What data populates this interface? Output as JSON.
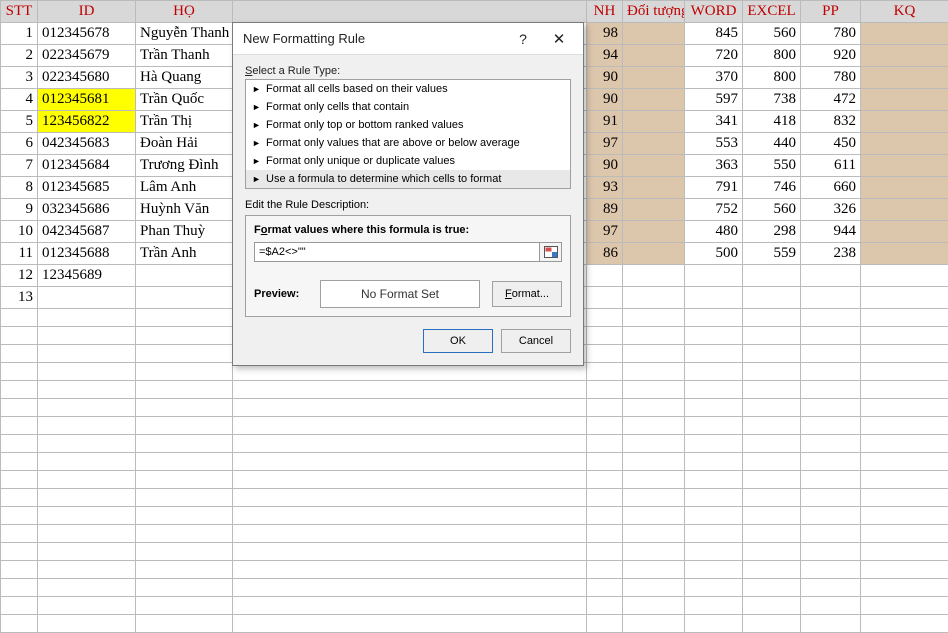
{
  "headers": {
    "stt": "STT",
    "id": "ID",
    "hq": "HỌ",
    "nh": "NH",
    "dt": "Đối tượng",
    "word": "WORD",
    "excel": "EXCEL",
    "pp": "PP",
    "kq": "KQ"
  },
  "rows": [
    {
      "stt": "1",
      "id": "012345678",
      "hq": "Nguyễn Thanh",
      "nh": "98",
      "word": "845",
      "excel": "560",
      "pp": "780",
      "hl": false
    },
    {
      "stt": "2",
      "id": "022345679",
      "hq": "Trần Thanh",
      "nh": "94",
      "word": "720",
      "excel": "800",
      "pp": "920",
      "hl": false
    },
    {
      "stt": "3",
      "id": "022345680",
      "hq": "Hà Quang",
      "nh": "90",
      "word": "370",
      "excel": "800",
      "pp": "780",
      "hl": false
    },
    {
      "stt": "4",
      "id": "012345681",
      "hq": "Trần Quốc",
      "nh": "90",
      "word": "597",
      "excel": "738",
      "pp": "472",
      "hl": true
    },
    {
      "stt": "5",
      "id": "123456822",
      "hq": "Trần Thị",
      "nh": "91",
      "word": "341",
      "excel": "418",
      "pp": "832",
      "hl": true
    },
    {
      "stt": "6",
      "id": "042345683",
      "hq": "Đoàn Hải",
      "nh": "97",
      "word": "553",
      "excel": "440",
      "pp": "450",
      "hl": false
    },
    {
      "stt": "7",
      "id": "012345684",
      "hq": "Trương Đình",
      "nh": "90",
      "word": "363",
      "excel": "550",
      "pp": "611",
      "hl": false
    },
    {
      "stt": "8",
      "id": "012345685",
      "hq": "Lâm Anh",
      "nh": "93",
      "word": "791",
      "excel": "746",
      "pp": "660",
      "hl": false
    },
    {
      "stt": "9",
      "id": "032345686",
      "hq": "Huỳnh Văn",
      "nh": "89",
      "word": "752",
      "excel": "560",
      "pp": "326",
      "hl": false
    },
    {
      "stt": "10",
      "id": "042345687",
      "hq": "Phan Thuỳ",
      "nh": "97",
      "word": "480",
      "excel": "298",
      "pp": "944",
      "hl": false
    },
    {
      "stt": "11",
      "id": "012345688",
      "hq": "Trần Anh",
      "nh": "86",
      "word": "500",
      "excel": "559",
      "pp": "238",
      "hl": false
    }
  ],
  "extra_rows": [
    {
      "stt": "12",
      "id": "12345689"
    },
    {
      "stt": "13",
      "id": ""
    }
  ],
  "dialog": {
    "title": "New Formatting Rule",
    "help": "?",
    "close": "✕",
    "select_label": "Select a Rule Type:",
    "rule_types": [
      "Format all cells based on their values",
      "Format only cells that contain",
      "Format only top or bottom ranked values",
      "Format only values that are above or below average",
      "Format only unique or duplicate values",
      "Use a formula to determine which cells to format"
    ],
    "edit_label": "Edit the Rule Description:",
    "formula_label": "Format values where this formula is true:",
    "formula_value": "=$A2<>\"\"",
    "preview_label": "Preview:",
    "preview_text": "No Format Set",
    "format_btn": "Format...",
    "ok": "OK",
    "cancel": "Cancel"
  }
}
